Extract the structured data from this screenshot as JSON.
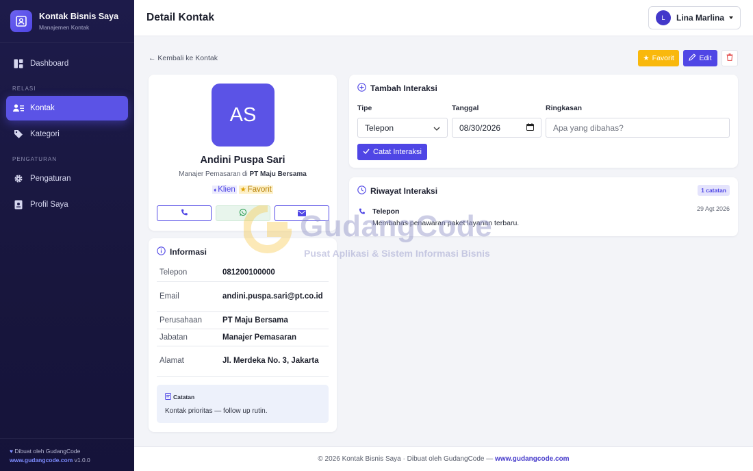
{
  "app": {
    "name": "Kontak Bisnis Saya",
    "subtitle": "Manajemen Kontak"
  },
  "sidebar": {
    "items": [
      {
        "label": "Dashboard",
        "icon": "dashboard-icon",
        "active": false
      },
      {
        "section": "RELASI"
      },
      {
        "label": "Kontak",
        "icon": "contacts-icon",
        "active": true
      },
      {
        "label": "Kategori",
        "icon": "tag-icon",
        "active": false
      },
      {
        "section": "PENGATURAN"
      },
      {
        "label": "Pengaturan",
        "icon": "gear-icon",
        "active": false
      },
      {
        "label": "Profil Saya",
        "icon": "id-card-icon",
        "active": false
      }
    ],
    "footer": {
      "credit": "Dibuat oleh GudangCode",
      "link": "www.gudangcode.com",
      "version": "v1.0.0"
    }
  },
  "header": {
    "title": "Detail Kontak",
    "user_initial": "L",
    "user_name": "Lina Marlina"
  },
  "toolbar": {
    "back_label": "← Kembali ke Kontak",
    "favorite_label": "Favorit",
    "edit_label": "Edit"
  },
  "contact": {
    "initials": "AS",
    "name": "Andini Puspa Sari",
    "role_prefix": "Manajer Pemasaran di",
    "company": "PT Maju Bersama",
    "tags": [
      {
        "label": "Klien"
      },
      {
        "label": "Favorit"
      }
    ]
  },
  "info": {
    "title": "Informasi",
    "rows": [
      {
        "key": "Telepon",
        "value": "081200100000"
      },
      {
        "key": "Email",
        "value": "andini.puspa.sari@pt.co.id"
      },
      {
        "key": "Perusahaan",
        "value": "PT Maju Bersama"
      },
      {
        "key": "Jabatan",
        "value": "Manajer Pemasaran"
      },
      {
        "key": "Alamat",
        "value": "Jl. Merdeka No. 3, Jakarta"
      }
    ],
    "note_title": "Catatan",
    "note_text": "Kontak prioritas — follow up rutin."
  },
  "add_interaction": {
    "title": "Tambah Interaksi",
    "type_label": "Tipe",
    "type_value": "Telepon",
    "date_label": "Tanggal",
    "date_value": "08/30/2026",
    "summary_label": "Ringkasan",
    "summary_placeholder": "Apa yang dibahas?",
    "submit_label": "Catat Interaksi"
  },
  "history": {
    "title": "Riwayat Interaksi",
    "count_badge": "1 catatan",
    "items": [
      {
        "type": "Telepon",
        "date": "29 Agt 2026",
        "text": "Membahas penawaran paket layanan terbaru."
      }
    ]
  },
  "footer": {
    "text": "© 2026 Kontak Bisnis Saya · Dibuat oleh GudangCode —",
    "link": "www.gudangcode.com"
  },
  "watermark": {
    "brand": "GudangCode",
    "tagline": "Pusat Aplikasi & Sistem Informasi Bisnis"
  },
  "colors": {
    "accent": "#4f46e5",
    "sidebar_bg": "#1d1b4a",
    "favorite": "#f9b80c",
    "danger": "#e24a4a"
  }
}
